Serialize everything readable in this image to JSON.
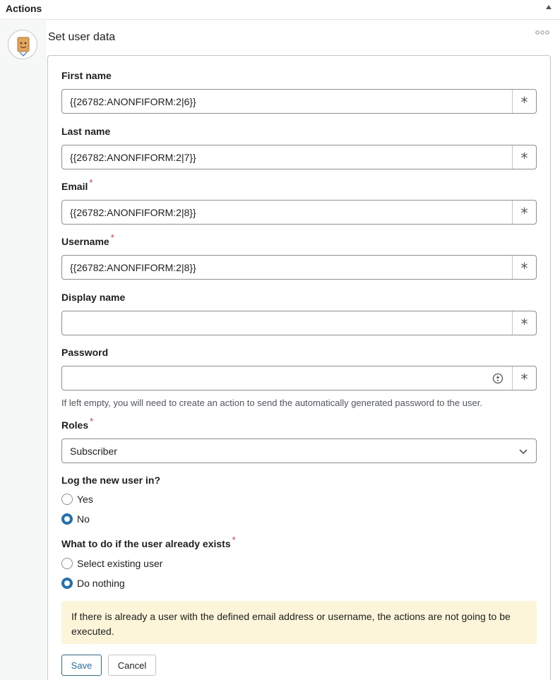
{
  "header": {
    "title": "Actions",
    "collapse_icon": "triangle-up-icon"
  },
  "action": {
    "title": "Set user data",
    "avatar_icon": "bot-avatar-icon",
    "more_icon": "ellipsis-icon"
  },
  "fields": {
    "first_name": {
      "label": "First name",
      "value": "{{26782:ANONFIFORM:2|6}}",
      "required": false
    },
    "last_name": {
      "label": "Last name",
      "value": "{{26782:ANONFIFORM:2|7}}",
      "required": false
    },
    "email": {
      "label": "Email",
      "value": "{{26782:ANONFIFORM:2|8}}",
      "required": true
    },
    "username": {
      "label": "Username",
      "value": "{{26782:ANONFIFORM:2|8}}",
      "required": true
    },
    "display_name": {
      "label": "Display name",
      "value": "",
      "required": false
    },
    "password": {
      "label": "Password",
      "value": "",
      "required": false,
      "help": "If left empty, you will need to create an action to send the automatically generated password to the user."
    }
  },
  "token_addon_symbol": "*",
  "required_marker": "*",
  "roles": {
    "label": "Roles",
    "selected": "Subscriber",
    "required": true
  },
  "log_in": {
    "label": "Log the new user in?",
    "options": [
      "Yes",
      "No"
    ],
    "selected": "No"
  },
  "existing_user": {
    "label": "What to do if the user already exists",
    "required": true,
    "options": [
      "Select existing user",
      "Do nothing"
    ],
    "selected": "Do nothing"
  },
  "notice": "If there is already a user with the defined email address or username, the actions are not going to be executed.",
  "buttons": {
    "save": "Save",
    "cancel": "Cancel"
  },
  "colors": {
    "accent": "#2271b1",
    "required": "#d63638",
    "notice_bg": "#fcf5d9"
  }
}
